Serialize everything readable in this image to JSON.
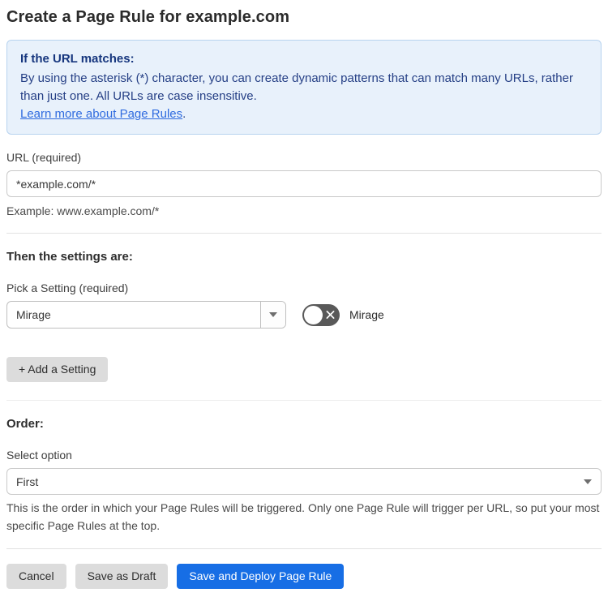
{
  "page": {
    "title": "Create a Page Rule for example.com"
  },
  "info_box": {
    "heading": "If the URL matches:",
    "body": "By using the asterisk (*) character, you can create dynamic patterns that can match many URLs, rather than just one. All URLs are case insensitive.",
    "link_label": "Learn more about Page Rules",
    "link_suffix": "."
  },
  "url_field": {
    "label": "URL (required)",
    "value": "*example.com/*",
    "helper": "Example: www.example.com/*"
  },
  "settings_section": {
    "heading": "Then the settings are:",
    "picker_label": "Pick a Setting (required)",
    "picker_value": "Mirage",
    "toggle_state": "off",
    "toggle_label": "Mirage",
    "add_button_label": "+ Add a Setting"
  },
  "order_section": {
    "heading": "Order:",
    "select_label": "Select option",
    "select_value": "First",
    "helper": "This is the order in which your Page Rules will be triggered. Only one Page Rule will trigger per URL, so put your most specific Page Rules at the top."
  },
  "footer": {
    "cancel_label": "Cancel",
    "save_draft_label": "Save as Draft",
    "save_deploy_label": "Save and Deploy Page Rule"
  },
  "colors": {
    "accent_blue": "#176ee5",
    "info_background": "#e8f1fb",
    "info_border": "#b7d3ef",
    "info_text": "#253f85",
    "link_blue": "#2f6bdf",
    "toggle_off_gray": "#595959",
    "button_gray": "#dcdcdc"
  }
}
